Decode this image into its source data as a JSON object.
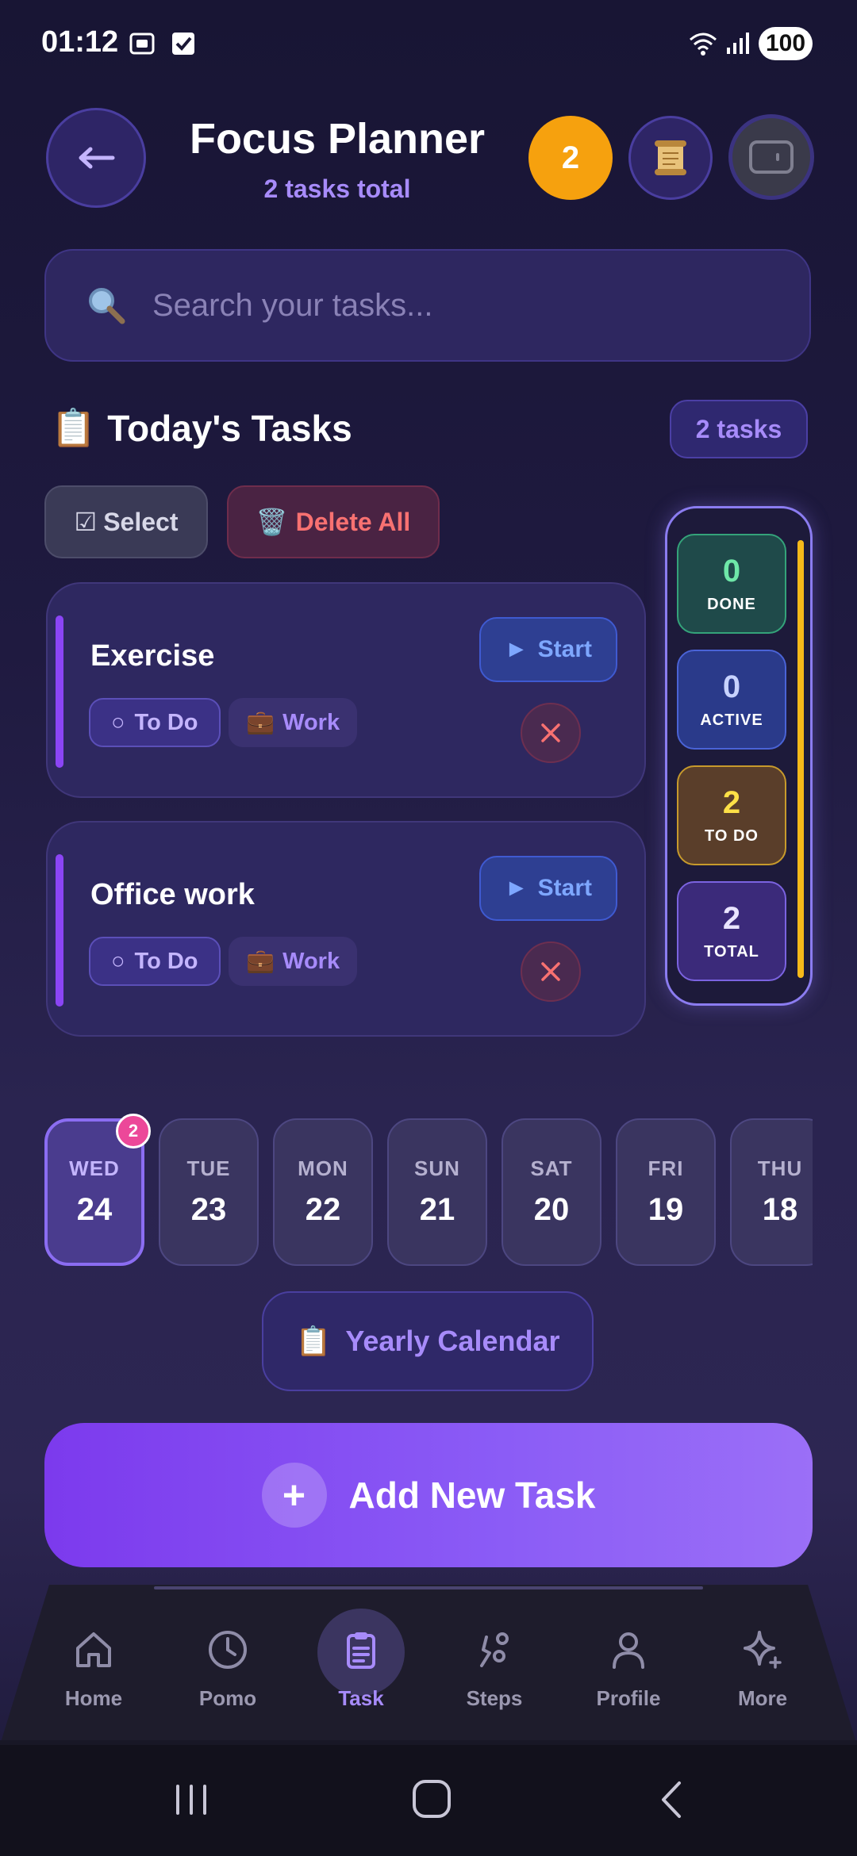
{
  "status_bar": {
    "time": "01:12",
    "battery": "100"
  },
  "header": {
    "title": "Focus Planner",
    "subtitle": "2 tasks total",
    "count_badge": "2"
  },
  "search": {
    "placeholder": "Search your tasks..."
  },
  "section": {
    "emoji": "📋",
    "title": "Today's Tasks",
    "tasks_pill": "2 tasks",
    "select_label": "Select",
    "select_glyph": "☑",
    "delete_label": "Delete All",
    "delete_glyph": "🗑️"
  },
  "tasks": [
    {
      "name": "Exercise",
      "status_glyph": "○",
      "status": "To Do",
      "category_glyph": "💼",
      "category": "Work",
      "start_glyph": "►",
      "start_label": "Start"
    },
    {
      "name": "Office work",
      "status_glyph": "○",
      "status": "To Do",
      "category_glyph": "💼",
      "category": "Work",
      "start_glyph": "►",
      "start_label": "Start"
    }
  ],
  "stats": [
    {
      "value": "0",
      "label": "DONE",
      "color": "#6ee7a8"
    },
    {
      "value": "0",
      "label": "ACTIVE",
      "color": "#c7d2fe"
    },
    {
      "value": "2",
      "label": "TO DO",
      "color": "#fde047"
    },
    {
      "value": "2",
      "label": "TOTAL",
      "color": "#e9e4ff"
    }
  ],
  "dates": [
    {
      "day": "WED",
      "num": "24",
      "active": true,
      "badge": "2"
    },
    {
      "day": "TUE",
      "num": "23"
    },
    {
      "day": "MON",
      "num": "22"
    },
    {
      "day": "SUN",
      "num": "21"
    },
    {
      "day": "SAT",
      "num": "20"
    },
    {
      "day": "FRI",
      "num": "19"
    },
    {
      "day": "THU",
      "num": "18"
    }
  ],
  "yearly_calendar": {
    "emoji": "📋",
    "label": "Yearly Calendar"
  },
  "add_task": {
    "plus": "+",
    "label": "Add New Task"
  },
  "nav": [
    {
      "label": "Home",
      "icon": "home-icon"
    },
    {
      "label": "Pomo",
      "icon": "clock-icon"
    },
    {
      "label": "Task",
      "icon": "clipboard-icon",
      "active": true
    },
    {
      "label": "Steps",
      "icon": "steps-icon"
    },
    {
      "label": "Profile",
      "icon": "person-icon"
    },
    {
      "label": "More",
      "icon": "sparkle-icon"
    }
  ],
  "colors": {
    "accent": "#8b5cf6",
    "orange": "#f6a10e",
    "danger": "#f87171",
    "start": "#7ea7ff"
  }
}
